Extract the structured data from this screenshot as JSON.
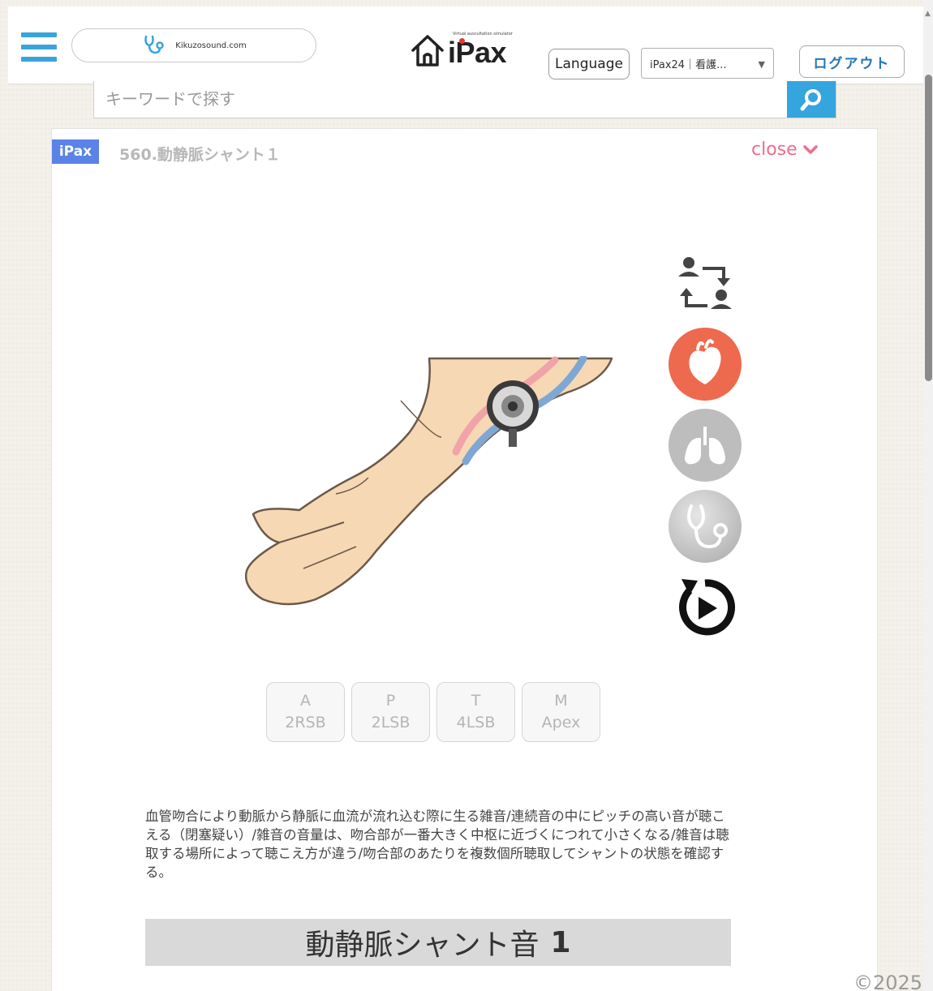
{
  "header": {
    "site_name": "Kikuzosound.com",
    "logo_tagline": "Virtual auscultation simulator",
    "logo_name": "iPax",
    "language_label": "Language",
    "product_select_value": "iPax24｜看護...",
    "logout_label": "ログアウト"
  },
  "search": {
    "placeholder": "キーワードで探す"
  },
  "panel": {
    "badge": "iPax",
    "title": "560.動静脈シャント１",
    "close_label": "close"
  },
  "positions": [
    {
      "top": "A",
      "bottom": "2RSB"
    },
    {
      "top": "P",
      "bottom": "2LSB"
    },
    {
      "top": "T",
      "bottom": "4LSB"
    },
    {
      "top": "M",
      "bottom": "Apex"
    }
  ],
  "description": "血管吻合により動脈から静脈に血流が流れ込む際に生る雑音/連続音の中にピッチの高い音が聴こえる（閉塞疑い）/雑音の音量は、吻合部が一番大きく中枢に近づくにつれて小さくなる/雑音は聴取する場所によって聴こえ方が違う/吻合部のあたりを複数個所聴取してシャントの状態を確認する。",
  "sound_title": {
    "text": "動静脈シャント音",
    "number": "1"
  },
  "footer": {
    "copyright": "©2025"
  },
  "colors": {
    "accent_blue": "#35a5dd",
    "badge_blue": "#5b82e6",
    "close_pink": "#ee6c8e",
    "heart_red": "#ed6a4e"
  }
}
